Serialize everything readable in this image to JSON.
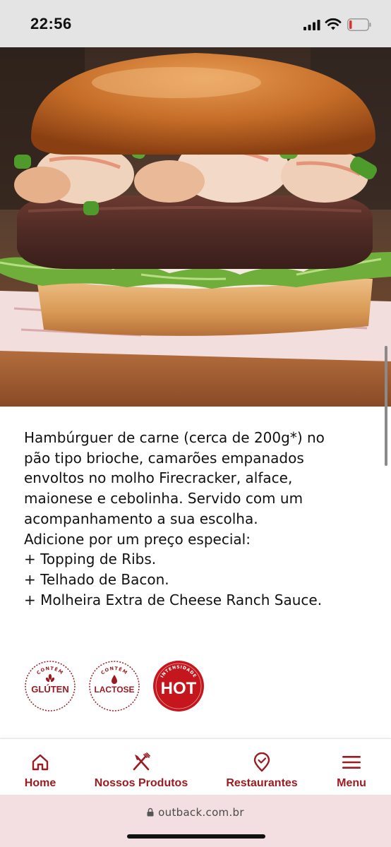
{
  "status_bar": {
    "time": "22:56",
    "icons": [
      "signal-icon",
      "wifi-icon",
      "battery-icon"
    ]
  },
  "hero": {
    "image": "burger-photo"
  },
  "description": {
    "lines": [
      "Hambúrguer de carne (cerca de 200g*) no",
      "pão tipo brioche, camarões empanados",
      "envoltos no molho Firecracker, alface,",
      "maionese e cebolinha. Servido com um",
      "acompanhamento a sua escolha.",
      "Adicione por um preço especial:",
      "+ Topping de Ribs.",
      "+ Telhado de Bacon.",
      "+ Molheira Extra de Cheese Ranch Sauce."
    ]
  },
  "badges": [
    {
      "top_text": "CONTÉM",
      "main_text": "GLÚTEN",
      "icon": "wheat-icon"
    },
    {
      "top_text": "CONTÉM",
      "main_text": "LACTOSE",
      "icon": "milk-drop-icon"
    },
    {
      "top_text": "INTENSIDADE",
      "main_text": "HOT",
      "icon": "hot-badge"
    }
  ],
  "bottom_nav": {
    "items": [
      {
        "label": "Home",
        "icon": "home-icon"
      },
      {
        "label": "Nossos Produtos",
        "icon": "fork-knife-icon"
      },
      {
        "label": "Restaurantes",
        "icon": "location-pin-icon"
      },
      {
        "label": "Menu",
        "icon": "hamburger-menu-icon"
      }
    ]
  },
  "browser": {
    "url": "outback.com.br"
  },
  "colors": {
    "brand_red": "#9b1b22",
    "hot_red": "#c4161c",
    "url_bar_bg": "#f3dfe1",
    "status_bar_bg": "#e4e4e4"
  }
}
